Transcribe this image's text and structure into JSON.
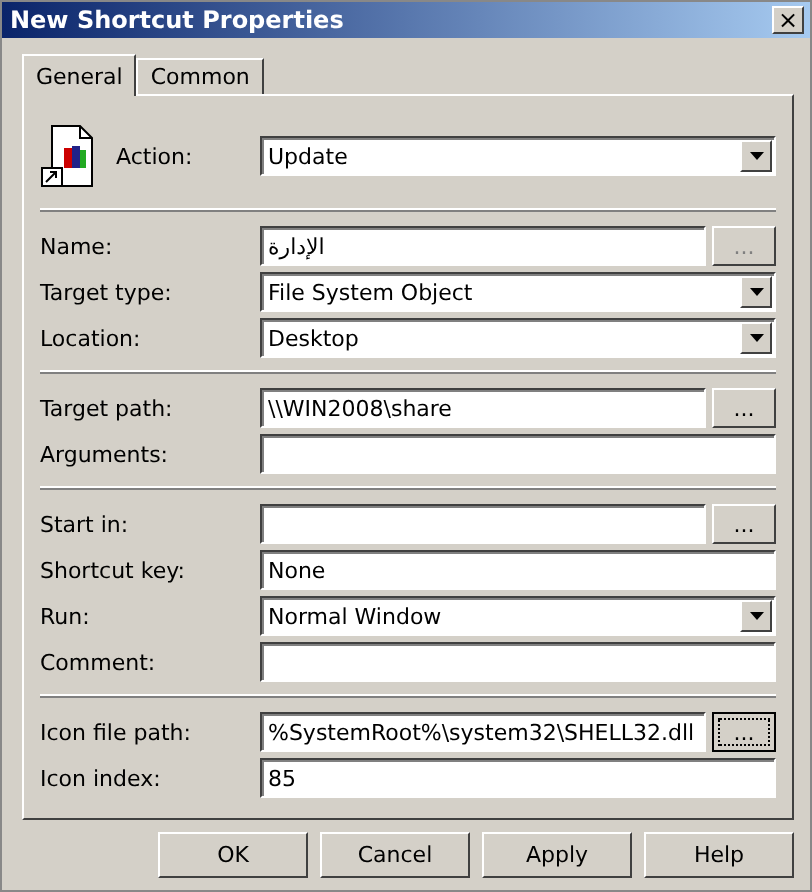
{
  "window": {
    "title": "New Shortcut Properties",
    "close": "×"
  },
  "tabs": [
    {
      "label": "General",
      "selected": true
    },
    {
      "label": "Common",
      "selected": false
    }
  ],
  "sections": [
    {
      "has_icon": true,
      "fields": [
        {
          "label": "Action:",
          "kind": "dropdown",
          "value": "Update"
        }
      ]
    },
    {
      "fields": [
        {
          "label": "Name:",
          "kind": "text",
          "value": "الإدارة",
          "browse": {
            "label": "...",
            "disabled": true,
            "focused": false
          }
        },
        {
          "label": "Target type:",
          "kind": "dropdown",
          "value": "File System Object"
        },
        {
          "label": "Location:",
          "kind": "dropdown",
          "value": "Desktop"
        }
      ]
    },
    {
      "fields": [
        {
          "label": "Target path:",
          "kind": "text",
          "value": "\\\\WIN2008\\share",
          "browse": {
            "label": "...",
            "disabled": false,
            "focused": false
          }
        },
        {
          "label": "Arguments:",
          "kind": "text"
        }
      ]
    },
    {
      "fields": [
        {
          "label": "Start in:",
          "kind": "text",
          "browse": {
            "label": "...",
            "disabled": false,
            "focused": false
          }
        },
        {
          "label": "Shortcut key:",
          "kind": "text",
          "value": "None"
        },
        {
          "label": "Run:",
          "kind": "dropdown",
          "value": "Normal Window"
        },
        {
          "label": "Comment:",
          "kind": "text"
        }
      ]
    },
    {
      "fields": [
        {
          "label": "Icon file path:",
          "kind": "text",
          "value": "%SystemRoot%\\system32\\SHELL32.dll",
          "browse": {
            "label": "...",
            "disabled": false,
            "focused": true
          }
        },
        {
          "label": "Icon index:",
          "kind": "text",
          "value": "85"
        }
      ]
    }
  ],
  "buttons": [
    "OK",
    "Cancel",
    "Apply",
    "Help"
  ]
}
